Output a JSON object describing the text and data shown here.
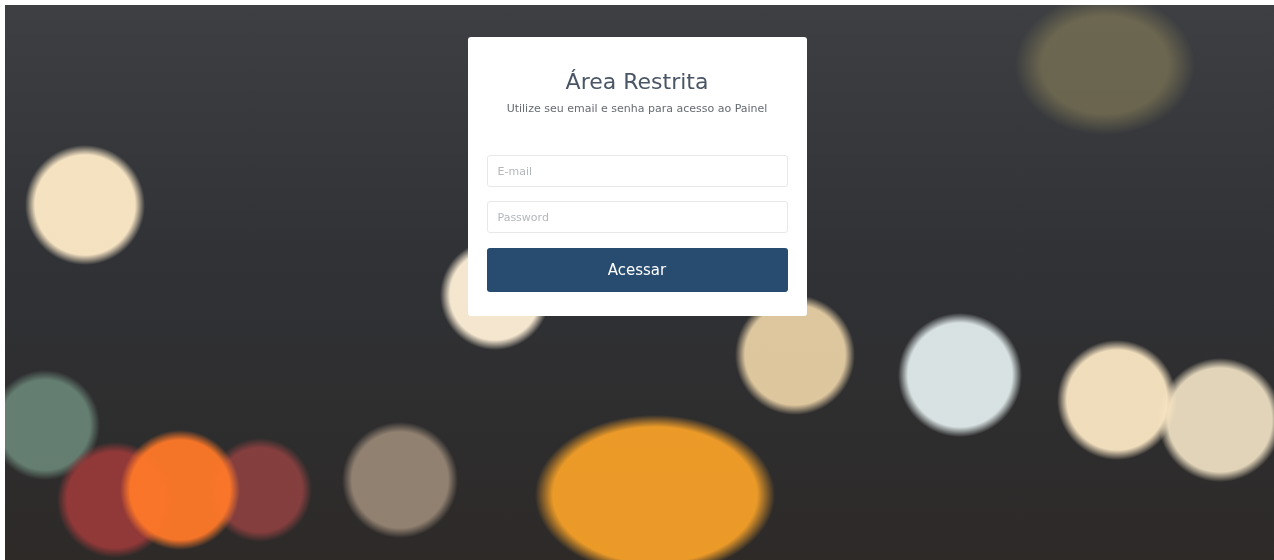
{
  "login_card": {
    "title": "Área Restrita",
    "subtitle": "Utilize seu email e senha para acesso ao Painel",
    "fields": [
      {
        "placeholder": "E-mail"
      },
      {
        "placeholder": "Password"
      }
    ],
    "submit_button": "Acessar"
  }
}
